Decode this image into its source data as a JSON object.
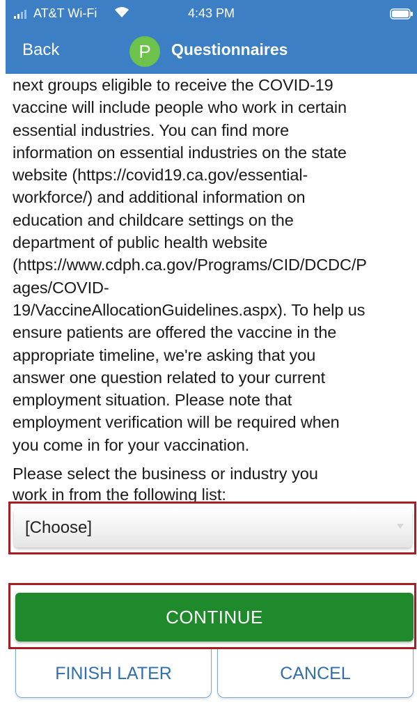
{
  "status_bar": {
    "carrier": "AT&T Wi-Fi",
    "time": "4:43 PM"
  },
  "nav": {
    "back_label": "Back",
    "badge_letter": "P",
    "title": "Questionnaires"
  },
  "body": {
    "paragraph": "next groups eligible to receive the COVID-19\nvaccine will include people who work in certain\nessential industries. You can find more\ninformation on essential industries on the state\nwebsite (https://covid19.ca.gov/essential-\nworkforce/) and additional information on\neducation and childcare settings on the\ndepartment of public health website\n(https://www.cdph.ca.gov/Programs/CID/DCDC/P\nages/COVID-\n19/VaccineAllocationGuidelines.aspx). To help us\nensure patients are offered the vaccine in the\nappropriate timeline, we're asking that you\nanswer one question related to your current\nemployment situation. Please note that\nemployment verification will be required when\nyou come in for your vaccination.",
    "prompt": "Please select the business or industry you\nwork in from the following list:"
  },
  "industry_select": {
    "selected": "[Choose]"
  },
  "buttons": {
    "continue": "CONTINUE",
    "finish_later": "FINISH LATER",
    "cancel": "CANCEL"
  },
  "colors": {
    "header_bg": "#3d7fc4",
    "badge_bg": "#6cc24a",
    "continue_bg": "#1f8a2c",
    "highlight_border": "#a61d22",
    "secondary_text": "#2f6fb0"
  }
}
